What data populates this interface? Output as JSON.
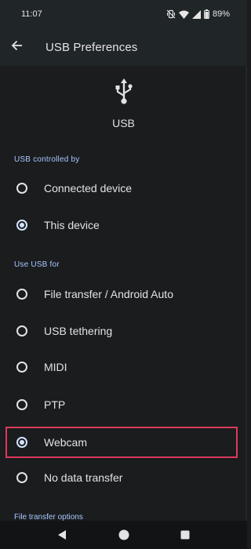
{
  "status_bar": {
    "time": "11:07",
    "battery": "89%",
    "icons": [
      "vibrate-mute-icon",
      "wifi-icon",
      "signal-icon",
      "battery-icon"
    ]
  },
  "app_bar": {
    "title": "USB Preferences",
    "back_icon": "arrow-back-icon"
  },
  "header": {
    "icon": "usb-icon",
    "label": "USB"
  },
  "sections": {
    "controlled_by": {
      "title": "USB controlled by",
      "options": [
        {
          "label": "Connected device",
          "selected": false
        },
        {
          "label": "This device",
          "selected": true
        }
      ]
    },
    "use_for": {
      "title": "Use USB for",
      "options": [
        {
          "label": "File transfer / Android Auto",
          "selected": false
        },
        {
          "label": "USB tethering",
          "selected": false
        },
        {
          "label": "MIDI",
          "selected": false
        },
        {
          "label": "PTP",
          "selected": false
        },
        {
          "label": "Webcam",
          "selected": true
        },
        {
          "label": "No data transfer",
          "selected": false
        }
      ]
    },
    "file_transfer_options": {
      "title": "File transfer options"
    }
  },
  "nav_bar": {
    "icons": [
      "nav-back-icon",
      "nav-home-icon",
      "nav-recents-icon"
    ]
  },
  "colors": {
    "background": "#1a1c1e",
    "app_bar": "#202528",
    "accent": "#a8c8ff",
    "radio_selected": "#d3e3fd",
    "highlight_border": "#dc3a5b"
  }
}
